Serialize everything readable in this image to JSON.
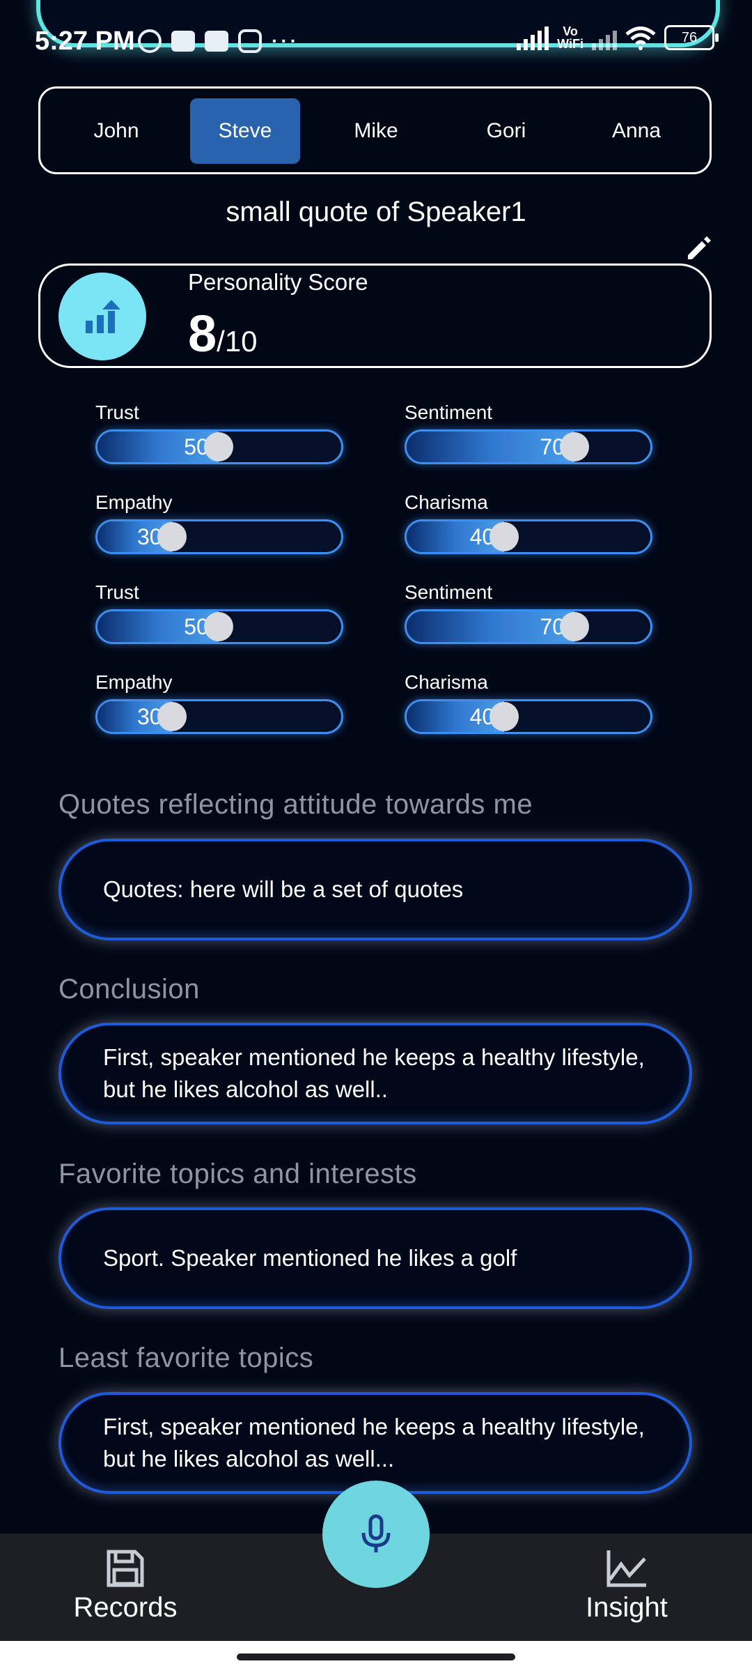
{
  "status_bar": {
    "time": "5:27 PM",
    "icons": [
      "alarm-icon",
      "youtube-icon",
      "upload-icon",
      "instagram-icon",
      "more-dots-icon"
    ],
    "more": "···",
    "vowifi_top": "Vo",
    "vowifi_bottom": "WiFi",
    "battery": "76"
  },
  "speakers": {
    "tabs": [
      "John",
      "Steve",
      "Mike",
      "Gori",
      "Anna"
    ],
    "selected": "Steve"
  },
  "quote_title": "small quote of Speaker1",
  "personality": {
    "label": "Personality Score",
    "score": "8",
    "max": "/10"
  },
  "sliders": [
    {
      "label": "Trust",
      "value": 50
    },
    {
      "label": "Sentiment",
      "value": 70
    },
    {
      "label": "Empathy",
      "value": 30
    },
    {
      "label": "Charisma",
      "value": 40
    },
    {
      "label": "Trust",
      "value": 50
    },
    {
      "label": "Sentiment",
      "value": 70
    },
    {
      "label": "Empathy",
      "value": 30
    },
    {
      "label": "Charisma",
      "value": 40
    }
  ],
  "sections": [
    {
      "title": "Quotes reflecting attitude towards me",
      "text": "Quotes: here will be a set of quotes"
    },
    {
      "title": "Conclusion",
      "text": "First, speaker mentioned he keeps a healthy lifestyle, but he likes alcohol as well.."
    },
    {
      "title": "Favorite topics and interests",
      "text": "Sport. Speaker mentioned he likes a golf"
    },
    {
      "title": "Least favorite topics",
      "text": "First, speaker mentioned he keeps a healthy lifestyle, but he likes alcohol as well..."
    }
  ],
  "bottom_nav": {
    "records_label": "Records",
    "insight_label": "Insight"
  },
  "colors": {
    "background": "#020716",
    "accent": "#2a63ad",
    "mic": "#6fd6e0",
    "slider_border": "#3e8ef0"
  }
}
